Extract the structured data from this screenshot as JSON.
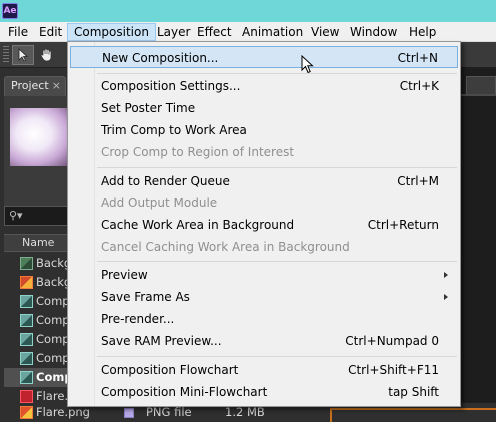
{
  "app": {
    "icon_text": "Ae"
  },
  "menubar": {
    "items": [
      {
        "label": "File"
      },
      {
        "label": "Edit"
      },
      {
        "label": "Composition"
      },
      {
        "label": "Layer"
      },
      {
        "label": "Effect"
      },
      {
        "label": "Animation"
      },
      {
        "label": "View"
      },
      {
        "label": "Window"
      },
      {
        "label": "Help"
      }
    ],
    "active": "Composition"
  },
  "toolbar": {
    "tools": [
      {
        "icon": "selection-arrow-icon"
      },
      {
        "icon": "hand-icon"
      }
    ]
  },
  "project_panel": {
    "tab_label": "Project",
    "tab_close": "×",
    "search_icon": "search-icon",
    "search_glyph": "⚲▾",
    "column_header": "Name",
    "files": [
      {
        "name": "Backg",
        "icon": "composition-icon"
      },
      {
        "name": "Backg",
        "icon": "image-file-icon"
      },
      {
        "name": "Comp",
        "icon": "composition-icon"
      },
      {
        "name": "Comp",
        "icon": "composition-icon"
      },
      {
        "name": "Comp",
        "icon": "composition-icon"
      },
      {
        "name": "Comp",
        "icon": "composition-icon"
      },
      {
        "name": "Comp",
        "icon": "composition-icon",
        "selected": true
      },
      {
        "name": "Flare.",
        "icon": "solid-icon"
      }
    ],
    "bottom_file": {
      "name": "Flare.png",
      "type": "PNG file",
      "size": "1.2 MB"
    }
  },
  "composition_menu": {
    "items": [
      {
        "label": "New Composition...",
        "shortcut": "Ctrl+N",
        "hover": true
      },
      {
        "separator": true
      },
      {
        "label": "Composition Settings...",
        "shortcut": "Ctrl+K"
      },
      {
        "label": "Set Poster Time",
        "shortcut": ""
      },
      {
        "label": "Trim Comp to Work Area",
        "shortcut": ""
      },
      {
        "label": "Crop Comp to Region of Interest",
        "shortcut": "",
        "disabled": true
      },
      {
        "separator": true
      },
      {
        "label": "Add to Render Queue",
        "shortcut": "Ctrl+M"
      },
      {
        "label": "Add Output Module",
        "shortcut": "",
        "disabled": true
      },
      {
        "label": "Cache Work Area in Background",
        "shortcut": "Ctrl+Return"
      },
      {
        "label": "Cancel Caching Work Area in Background",
        "shortcut": "",
        "disabled": true
      },
      {
        "separator": true
      },
      {
        "label": "Preview",
        "shortcut": "",
        "submenu": true
      },
      {
        "label": "Save Frame As",
        "shortcut": "",
        "submenu": true
      },
      {
        "label": "Pre-render...",
        "shortcut": ""
      },
      {
        "label": "Save RAM Preview...",
        "shortcut": "Ctrl+Numpad 0"
      },
      {
        "separator": true
      },
      {
        "label": "Composition Flowchart",
        "shortcut": "Ctrl+Shift+F11"
      },
      {
        "label": "Composition Mini-Flowchart",
        "shortcut": "tap Shift"
      }
    ]
  },
  "colors": {
    "titlebar": "#6fd7d7",
    "menu_bg": "#f0f0f0",
    "hover_bg": "#d4e6f6",
    "hover_border": "#7ab0e0",
    "panel_bg": "#2f2f2f",
    "disabled_text": "#8f8f8f"
  }
}
